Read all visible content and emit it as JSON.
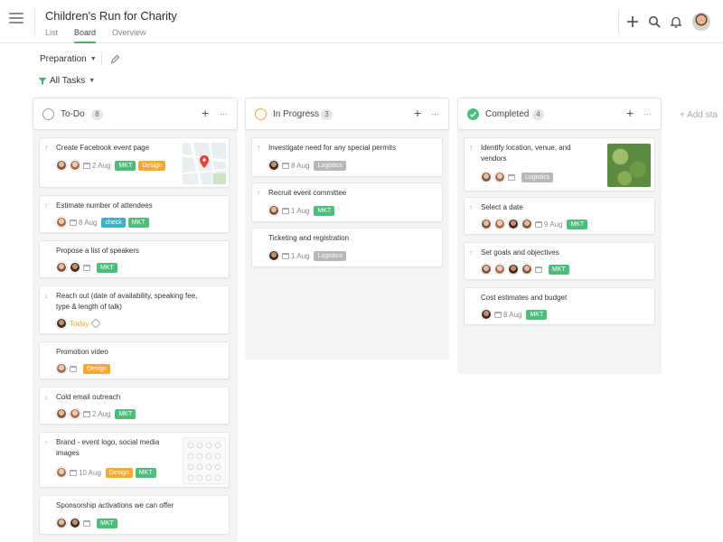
{
  "header": {
    "project_title": "Children's Run for Charity",
    "views": [
      {
        "label": "List",
        "active": false
      },
      {
        "label": "Board",
        "active": true
      },
      {
        "label": "Overview",
        "active": false
      }
    ],
    "icons": [
      "plus-icon",
      "search-icon",
      "bell-icon",
      "user-avatar"
    ]
  },
  "filters": {
    "section": "Preparation",
    "tasks_filter": "All Tasks"
  },
  "colors": {
    "accent": "#41b66d",
    "mkt": "#4ebc7b",
    "design": "#f3a934",
    "check": "#3fb0c5",
    "logistics": "#b7b7b7",
    "in_progress": "#f3a934",
    "priority_high": "#f08a5d",
    "priority_low": "#5aa0c8"
  },
  "columns": [
    {
      "title": "To-Do",
      "count": "8",
      "cards": [
        {
          "title": "Create Facebook event page",
          "priority": "up",
          "date": "2 Aug",
          "tags": [
            "MKT",
            "Design"
          ],
          "thumb": "map"
        },
        {
          "title": "Estimate number of attendees",
          "priority": "up",
          "date": "8 Aug",
          "tags": [
            "check",
            "MKT"
          ]
        },
        {
          "title": "Propose a list of speakers",
          "priority": "",
          "date": "",
          "tags": [
            "MKT"
          ]
        },
        {
          "title_lines": [
            "Reach out (date of availability, speaking fee,",
            "type & length of talk)"
          ],
          "priority": "down",
          "date": "Today",
          "tags": []
        },
        {
          "title": "Promotion video",
          "priority": "",
          "date": "",
          "tags": [
            "Design"
          ]
        },
        {
          "title": "Cold email outreach",
          "priority": "down",
          "date": "2 Aug",
          "tags": [
            "MKT"
          ]
        },
        {
          "title_lines": [
            "Brand - event logo, social media",
            "images"
          ],
          "priority": "up",
          "date": "10 Aug",
          "tags": [
            "Design",
            "MKT"
          ],
          "thumb": "sketch"
        },
        {
          "title": "Sponsorship activations we can offer",
          "priority": "",
          "date": "",
          "tags": [
            "MKT"
          ]
        }
      ]
    },
    {
      "title": "In Progress",
      "count": "3",
      "cards": [
        {
          "title": "Investigate need for any special permits",
          "priority": "up",
          "date": "8 Aug",
          "tags": [
            "Logistics"
          ]
        },
        {
          "title": "Recruit event committee",
          "priority": "up",
          "date": "1 Aug",
          "tags": [
            "MKT"
          ]
        },
        {
          "title": "Ticketing and registration",
          "priority": "",
          "date": "1 Aug",
          "tags": [
            "Logistics"
          ]
        }
      ]
    },
    {
      "title": "Completed",
      "count": "4",
      "cards": [
        {
          "title_lines": [
            "Identify location, venue, and",
            "vendors"
          ],
          "priority": "up",
          "date": "",
          "tags": [
            "Logistics"
          ],
          "thumb": "leaf"
        },
        {
          "title": "Select a date",
          "priority": "up",
          "date": "9 Aug",
          "tags": [
            "MKT"
          ]
        },
        {
          "title": "Set goals and objectives",
          "priority": "up",
          "date": "",
          "tags": [
            "MKT"
          ]
        },
        {
          "title": "Cost estimates and budget",
          "priority": "",
          "date": "8 Aug",
          "tags": [
            "MKT"
          ]
        }
      ]
    }
  ],
  "add_status_label": "Add sta"
}
